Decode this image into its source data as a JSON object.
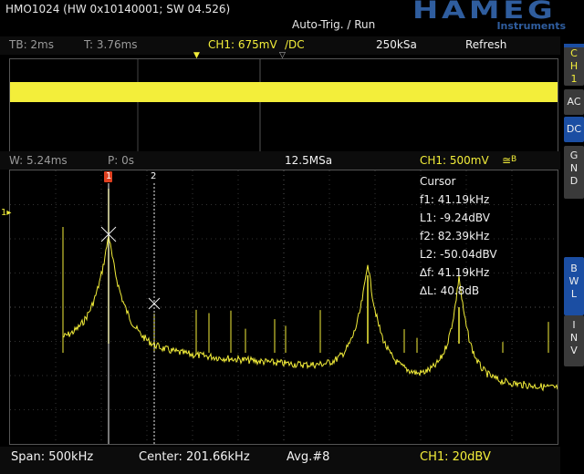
{
  "header": {
    "device": "HMO1024 (HW 0x10140001; SW 04.526)",
    "trigger_status": "Auto-Trig. / Run",
    "brand": "HAMEG",
    "brand_sub": "Instruments"
  },
  "top_bar": {
    "timebase": "TB: 2ms",
    "trigger_time": "T: 3.76ms",
    "channel": "CH1: 675mV",
    "coupling": "/DC",
    "sample_rate": "250kSa",
    "mode": "Refresh"
  },
  "fft_bar": {
    "window": "W: 5.24ms",
    "position": "P: 0s",
    "sample_rate": "12.5MSa",
    "channel": "CH1: 500mV",
    "coupling_symbol": "≅",
    "bw_symbol": "B"
  },
  "side_panel": {
    "channel": [
      "C",
      "H",
      "1"
    ],
    "ac": "AC",
    "dc": "DC",
    "gnd": [
      "G",
      "N",
      "D"
    ],
    "bwl": [
      "B",
      "W",
      "L"
    ],
    "inv": [
      "I",
      "N",
      "V"
    ]
  },
  "cursor": {
    "title": "Cursor",
    "f1": "f1: 41.19kHz",
    "l1": "L1: -9.24dBV",
    "f2": "f2: 82.39kHz",
    "l2": "L2: -50.04dBV",
    "df": "∆f: 41.19kHz",
    "dl": "∆L: 40.8dB",
    "marker1": "1",
    "marker2": "2"
  },
  "bottom_bar": {
    "span": "Span: 500kHz",
    "center": "Center: 201.66kHz",
    "avg": "Avg.#8",
    "scale": "CH1: 20dBV"
  },
  "colors": {
    "trace": "#f3ee3a",
    "accent_blue": "#1b4ea3",
    "marker_red": "#e04020"
  }
}
